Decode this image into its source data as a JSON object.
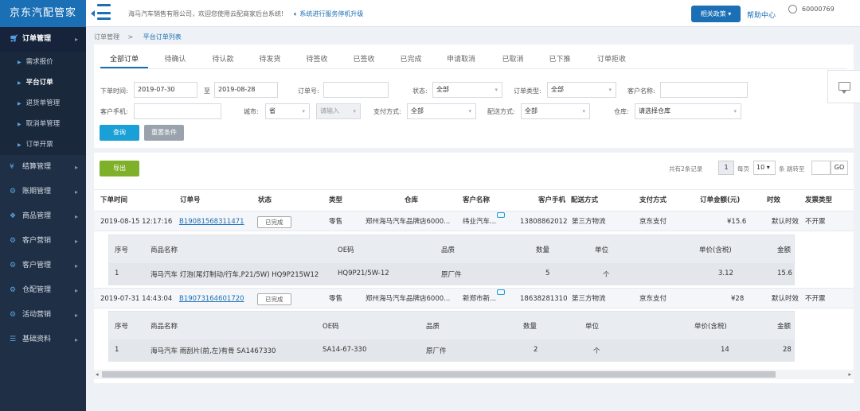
{
  "app": {
    "logo": "京东汽配管家"
  },
  "header": {
    "welcome": "海马汽车销售有限公司，欢迎您使用云配商家后台系统!",
    "notice": "系统进行服务停机升级",
    "policy_btn": "相关政策",
    "help": "帮助中心",
    "user_id": "60000769"
  },
  "sidebar": {
    "items": [
      {
        "label": "订单管理",
        "icon": "cart-icon"
      },
      {
        "label": "结算管理",
        "icon": "yen-icon"
      },
      {
        "label": "账期管理",
        "icon": "gears-icon"
      },
      {
        "label": "商品管理",
        "icon": "cubes-icon"
      },
      {
        "label": "客户营销",
        "icon": "gears-icon"
      },
      {
        "label": "客户管理",
        "icon": "gears-icon"
      },
      {
        "label": "仓配管理",
        "icon": "gears-icon"
      },
      {
        "label": "活动营销",
        "icon": "gears-icon"
      },
      {
        "label": "基础资料",
        "icon": "list-icon"
      }
    ],
    "subitems": [
      "需求报价",
      "平台订单",
      "退货单管理",
      "取消单管理",
      "订单开票"
    ]
  },
  "breadcrumb": {
    "root": "订单管理",
    "sep": ">",
    "current": "平台订单列表"
  },
  "tabs": [
    "全部订单",
    "待确认",
    "待认款",
    "待发货",
    "待签收",
    "已签收",
    "已完成",
    "申请取消",
    "已取消",
    "已下推",
    "订单拒收"
  ],
  "filters": {
    "order_time_label": "下单时间:",
    "date_from": "2019-07-30",
    "to_label": "至",
    "date_to": "2019-08-28",
    "order_no_label": "订单号:",
    "status_label": "状态:",
    "status_value": "全部",
    "order_type_label": "订单类型:",
    "order_type_value": "全部",
    "customer_name_label": "客户名称:",
    "customer_phone_label": "客户手机:",
    "city_label": "城市:",
    "province_value": "省",
    "city_placeholder": "请输入",
    "pay_label": "支付方式:",
    "pay_value": "全部",
    "delivery_label": "配送方式:",
    "delivery_value": "全部",
    "warehouse_label": "仓库:",
    "warehouse_value": "请选择仓库",
    "query_btn": "查询",
    "reset_btn": "重置条件"
  },
  "list": {
    "export_btn": "导出",
    "pager": {
      "total": "共有2条记录",
      "page": "1",
      "per_page_label": "每页",
      "per_page": "10",
      "unit": "条",
      "jump_label": "跳转至",
      "go": "GO"
    },
    "columns": [
      "下单时间",
      "订单号",
      "状态",
      "类型",
      "仓库",
      "客户名称",
      "客户手机",
      "配送方式",
      "支付方式",
      "订单金额(元)",
      "时效",
      "发票类型"
    ],
    "orders": [
      {
        "time": "2019-08-15 12:17:16",
        "order_no": "B19081568311471",
        "status": "已完成",
        "type": "零售",
        "warehouse": "郑州海马汽车品牌店6000...",
        "customer": "纬业汽车...",
        "phone": "13808862012",
        "delivery": "第三方物流",
        "pay": "京东支付",
        "amount": "¥15.6",
        "timeliness": "默认时效",
        "invoice": "不开票",
        "items_header": [
          "序号",
          "商品名称",
          "OE码",
          "品质",
          "数量",
          "单位",
          "单价(含税)",
          "金额"
        ],
        "items": [
          [
            "1",
            "海马汽车 灯泡(尾灯制动/行车,P21/5W) HQ9P215W12",
            "HQ9P21/5W-12",
            "原厂件",
            "5",
            "个",
            "3.12",
            "15.6"
          ]
        ]
      },
      {
        "time": "2019-07-31 14:43:04",
        "order_no": "B19073164601720",
        "status": "已完成",
        "type": "零售",
        "warehouse": "郑州海马汽车品牌店6000...",
        "customer": "新郑市新...",
        "phone": "18638281310",
        "delivery": "第三方物流",
        "pay": "京东支付",
        "amount": "¥28",
        "timeliness": "默认时效",
        "invoice": "不开票",
        "items_header": [
          "序号",
          "商品名称",
          "OE码",
          "品质",
          "数量",
          "单位",
          "单价(含税)",
          "金额"
        ],
        "items": [
          [
            "1",
            "海马汽车 雨刮片(前,左)有骨 SA1467330",
            "SA14-67-330",
            "原厂件",
            "2",
            "个",
            "14",
            "28"
          ]
        ]
      }
    ]
  },
  "colors": {
    "brand": "#1a6fb5",
    "sidebar": "#1f2f45",
    "query": "#1a9fd6",
    "export": "#7fb02a"
  }
}
